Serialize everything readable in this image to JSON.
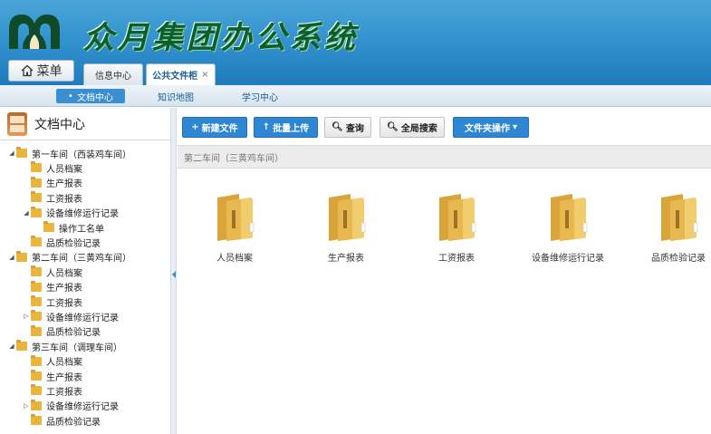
{
  "header": {
    "title": "众月集团办公系统",
    "menu_label": "菜单",
    "tabs": [
      {
        "label": "信息中心",
        "closable": false
      },
      {
        "label": "公共文件柜",
        "closable": true,
        "close_glyph": "×"
      }
    ]
  },
  "subnav": {
    "items": [
      {
        "label": "文档中心",
        "bullet": "•",
        "active": true
      },
      {
        "label": "知识地图",
        "active": false
      },
      {
        "label": "学习中心",
        "active": false
      }
    ]
  },
  "sidebar": {
    "title": "文档中心",
    "tree": [
      {
        "label": "第一车间（西装鸡车间）",
        "level": 0,
        "expander": "◢"
      },
      {
        "label": "人员档案",
        "level": 1
      },
      {
        "label": "生产报表",
        "level": 1
      },
      {
        "label": "工资报表",
        "level": 1
      },
      {
        "label": "设备维修运行记录",
        "level": 1,
        "expander": "◢"
      },
      {
        "label": "操作工名单",
        "level": 2
      },
      {
        "label": "品质检验记录",
        "level": 1
      },
      {
        "label": "第二车间（三黄鸡车间）",
        "level": 0,
        "expander": "◢"
      },
      {
        "label": "人员档案",
        "level": 1
      },
      {
        "label": "生产报表",
        "level": 1
      },
      {
        "label": "工资报表",
        "level": 1
      },
      {
        "label": "设备维修运行记录",
        "level": 1,
        "expander": "▷"
      },
      {
        "label": "品质检验记录",
        "level": 1
      },
      {
        "label": "第三车间（调理车间）",
        "level": 0,
        "expander": "◢"
      },
      {
        "label": "人员档案",
        "level": 1
      },
      {
        "label": "生产报表",
        "level": 1
      },
      {
        "label": "工资报表",
        "level": 1
      },
      {
        "label": "设备维修运行记录",
        "level": 1,
        "expander": "▷"
      },
      {
        "label": "品质检验记录",
        "level": 1
      }
    ]
  },
  "toolbar": {
    "new_file": {
      "icon": "+",
      "label": "新建文件"
    },
    "batch_upload": {
      "icon": "↑",
      "label": "批量上传"
    },
    "query": {
      "icon": "🔍︎",
      "label": "查询"
    },
    "global_search": {
      "icon": "🔍︎",
      "label": "全局搜索"
    },
    "folder_ops": {
      "label": "文件夹操作",
      "caret": "▾"
    }
  },
  "breadcrumb": "第二车间（三黄鸡车间）",
  "files": [
    {
      "label": "人员档案",
      "icon": "folder-icon"
    },
    {
      "label": "生产报表",
      "icon": "folder-icon"
    },
    {
      "label": "工资报表",
      "icon": "folder-icon"
    },
    {
      "label": "设备维修运行记录",
      "icon": "folder-icon"
    },
    {
      "label": "品质检验记录",
      "icon": "folder-icon"
    }
  ],
  "colors": {
    "header_blue": "#2f8fcb",
    "title_green": "#0c5f2c",
    "button_blue": "#2f86d3",
    "folder_yellow": "#e8b63c"
  }
}
